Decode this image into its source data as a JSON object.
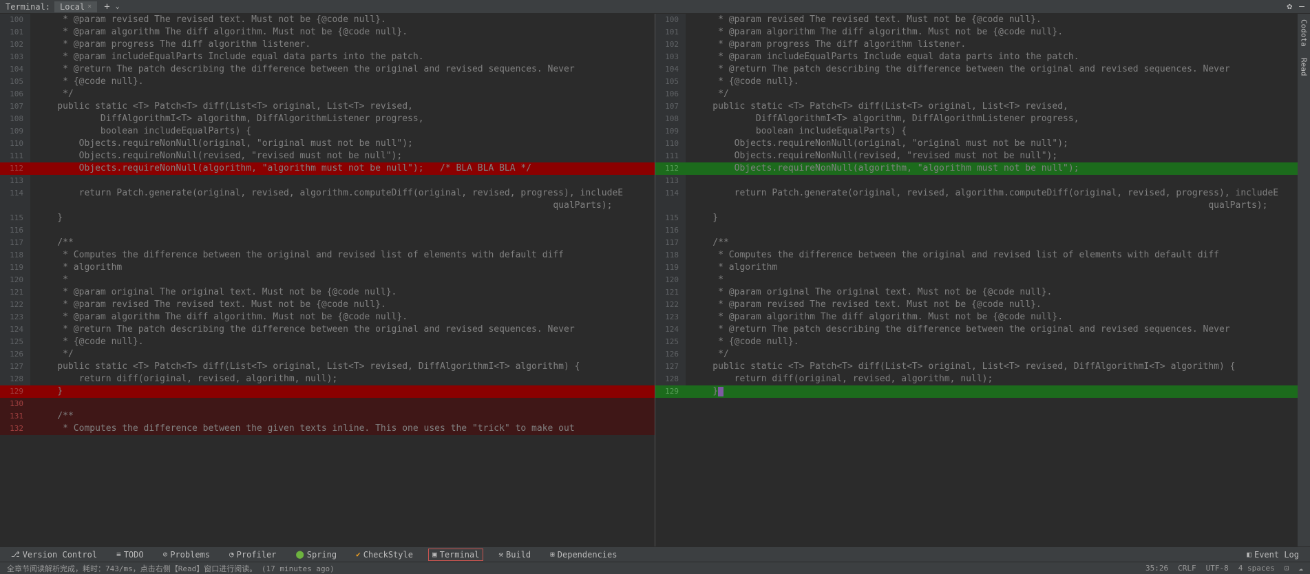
{
  "topbar": {
    "terminal_label": "Terminal:",
    "tab_label": "Local"
  },
  "left_lines": [
    {
      "n": "100",
      "t": "     * @param revised The revised text. Must not be {@code null}.",
      "cls": ""
    },
    {
      "n": "101",
      "t": "     * @param algorithm The diff algorithm. Must not be {@code null}.",
      "cls": ""
    },
    {
      "n": "102",
      "t": "     * @param progress The diff algorithm listener.",
      "cls": ""
    },
    {
      "n": "103",
      "t": "     * @param includeEqualParts Include equal data parts into the patch.",
      "cls": ""
    },
    {
      "n": "104",
      "t": "     * @return The patch describing the difference between the original and revised sequences. Never",
      "cls": ""
    },
    {
      "n": "105",
      "t": "     * {@code null}.",
      "cls": ""
    },
    {
      "n": "106",
      "t": "     */",
      "cls": ""
    },
    {
      "n": "107",
      "t": "    public static <T> Patch<T> diff(List<T> original, List<T> revised,",
      "cls": ""
    },
    {
      "n": "108",
      "t": "            DiffAlgorithmI<T> algorithm, DiffAlgorithmListener progress,",
      "cls": ""
    },
    {
      "n": "109",
      "t": "            boolean includeEqualParts) {",
      "cls": ""
    },
    {
      "n": "110",
      "t": "        Objects.requireNonNull(original, \"original must not be null\");",
      "cls": ""
    },
    {
      "n": "111",
      "t": "        Objects.requireNonNull(revised, \"revised must not be null\");",
      "cls": ""
    },
    {
      "n": "112",
      "t": "        Objects.requireNonNull(algorithm, \"algorithm must not be null\");   /* BLA BLA BLA */",
      "cls": "line-deleted-strong",
      "gcls": "gutter-red"
    },
    {
      "n": "113",
      "t": "",
      "cls": ""
    },
    {
      "n": "114",
      "t": "        return Patch.generate(original, revised, algorithm.computeDiff(original, revised, progress), includeE",
      "cls": ""
    },
    {
      "n": "",
      "t": "                                                                                                qualParts);",
      "cls": ""
    },
    {
      "n": "115",
      "t": "    }",
      "cls": ""
    },
    {
      "n": "116",
      "t": "",
      "cls": ""
    },
    {
      "n": "117",
      "t": "    /**",
      "cls": ""
    },
    {
      "n": "118",
      "t": "     * Computes the difference between the original and revised list of elements with default diff",
      "cls": ""
    },
    {
      "n": "119",
      "t": "     * algorithm",
      "cls": ""
    },
    {
      "n": "120",
      "t": "     *",
      "cls": ""
    },
    {
      "n": "121",
      "t": "     * @param original The original text. Must not be {@code null}.",
      "cls": ""
    },
    {
      "n": "122",
      "t": "     * @param revised The revised text. Must not be {@code null}.",
      "cls": ""
    },
    {
      "n": "123",
      "t": "     * @param algorithm The diff algorithm. Must not be {@code null}.",
      "cls": ""
    },
    {
      "n": "124",
      "t": "     * @return The patch describing the difference between the original and revised sequences. Never",
      "cls": ""
    },
    {
      "n": "125",
      "t": "     * {@code null}.",
      "cls": ""
    },
    {
      "n": "126",
      "t": "     */",
      "cls": ""
    },
    {
      "n": "127",
      "t": "    public static <T> Patch<T> diff(List<T> original, List<T> revised, DiffAlgorithmI<T> algorithm) {",
      "cls": ""
    },
    {
      "n": "128",
      "t": "        return diff(original, revised, algorithm, null);",
      "cls": ""
    },
    {
      "n": "129",
      "t": "    }",
      "cls": "line-deleted-strong",
      "gcls": "gutter-red"
    },
    {
      "n": "130",
      "t": "",
      "cls": "line-deleted-dark",
      "gcls": "gutter-red"
    },
    {
      "n": "131",
      "t": "    /**",
      "cls": "line-deleted-dark",
      "gcls": "gutter-red"
    },
    {
      "n": "132",
      "t": "     * Computes the difference between the given texts inline. This one uses the \"trick\" to make out",
      "cls": "line-deleted-dark",
      "gcls": "gutter-red"
    }
  ],
  "right_lines": [
    {
      "n": "100",
      "t": "     * @param revised The revised text. Must not be {@code null}.",
      "cls": ""
    },
    {
      "n": "101",
      "t": "     * @param algorithm The diff algorithm. Must not be {@code null}.",
      "cls": ""
    },
    {
      "n": "102",
      "t": "     * @param progress The diff algorithm listener.",
      "cls": ""
    },
    {
      "n": "103",
      "t": "     * @param includeEqualParts Include equal data parts into the patch.",
      "cls": ""
    },
    {
      "n": "104",
      "t": "     * @return The patch describing the difference between the original and revised sequences. Never",
      "cls": ""
    },
    {
      "n": "105",
      "t": "     * {@code null}.",
      "cls": ""
    },
    {
      "n": "106",
      "t": "     */",
      "cls": ""
    },
    {
      "n": "107",
      "t": "    public static <T> Patch<T> diff(List<T> original, List<T> revised,",
      "cls": ""
    },
    {
      "n": "108",
      "t": "            DiffAlgorithmI<T> algorithm, DiffAlgorithmListener progress,",
      "cls": ""
    },
    {
      "n": "109",
      "t": "            boolean includeEqualParts) {",
      "cls": ""
    },
    {
      "n": "110",
      "t": "        Objects.requireNonNull(original, \"original must not be null\");",
      "cls": ""
    },
    {
      "n": "111",
      "t": "        Objects.requireNonNull(revised, \"revised must not be null\");",
      "cls": ""
    },
    {
      "n": "112",
      "t": "        Objects.requireNonNull(algorithm, \"algorithm must not be null\");",
      "cls": "line-added-strong",
      "gcls": "gutter-green"
    },
    {
      "n": "113",
      "t": "",
      "cls": ""
    },
    {
      "n": "114",
      "t": "        return Patch.generate(original, revised, algorithm.computeDiff(original, revised, progress), includeE",
      "cls": ""
    },
    {
      "n": "",
      "t": "                                                                                                qualParts);",
      "cls": ""
    },
    {
      "n": "115",
      "t": "    }",
      "cls": ""
    },
    {
      "n": "116",
      "t": "",
      "cls": ""
    },
    {
      "n": "117",
      "t": "    /**",
      "cls": ""
    },
    {
      "n": "118",
      "t": "     * Computes the difference between the original and revised list of elements with default diff",
      "cls": ""
    },
    {
      "n": "119",
      "t": "     * algorithm",
      "cls": ""
    },
    {
      "n": "120",
      "t": "     *",
      "cls": ""
    },
    {
      "n": "121",
      "t": "     * @param original The original text. Must not be {@code null}.",
      "cls": ""
    },
    {
      "n": "122",
      "t": "     * @param revised The revised text. Must not be {@code null}.",
      "cls": ""
    },
    {
      "n": "123",
      "t": "     * @param algorithm The diff algorithm. Must not be {@code null}.",
      "cls": ""
    },
    {
      "n": "124",
      "t": "     * @return The patch describing the difference between the original and revised sequences. Never",
      "cls": ""
    },
    {
      "n": "125",
      "t": "     * {@code null}.",
      "cls": ""
    },
    {
      "n": "126",
      "t": "     */",
      "cls": ""
    },
    {
      "n": "127",
      "t": "    public static <T> Patch<T> diff(List<T> original, List<T> revised, DiffAlgorithmI<T> algorithm) {",
      "cls": ""
    },
    {
      "n": "128",
      "t": "        return diff(original, revised, algorithm, null);",
      "cls": ""
    },
    {
      "n": "129",
      "t": "    }",
      "cls": "line-added-strong",
      "gcls": "gutter-green",
      "cursor": true
    }
  ],
  "right_sidebar": {
    "codota": "Codota",
    "read": "Read"
  },
  "bottom_tools": {
    "version_control": "Version Control",
    "todo": "TODO",
    "problems": "Problems",
    "profiler": "Profiler",
    "spring": "Spring",
    "checkstyle": "CheckStyle",
    "terminal": "Terminal",
    "build": "Build",
    "dependencies": "Dependencies",
    "event_log": "Event Log"
  },
  "status": {
    "message": "全章节阅读解析完成，耗时：743/ms，点击右侧【Read】窗口进行阅读。 (17 minutes ago)",
    "cursor": "35:26",
    "line_sep": "CRLF",
    "encoding": "UTF-8",
    "indent": "4 spaces"
  }
}
